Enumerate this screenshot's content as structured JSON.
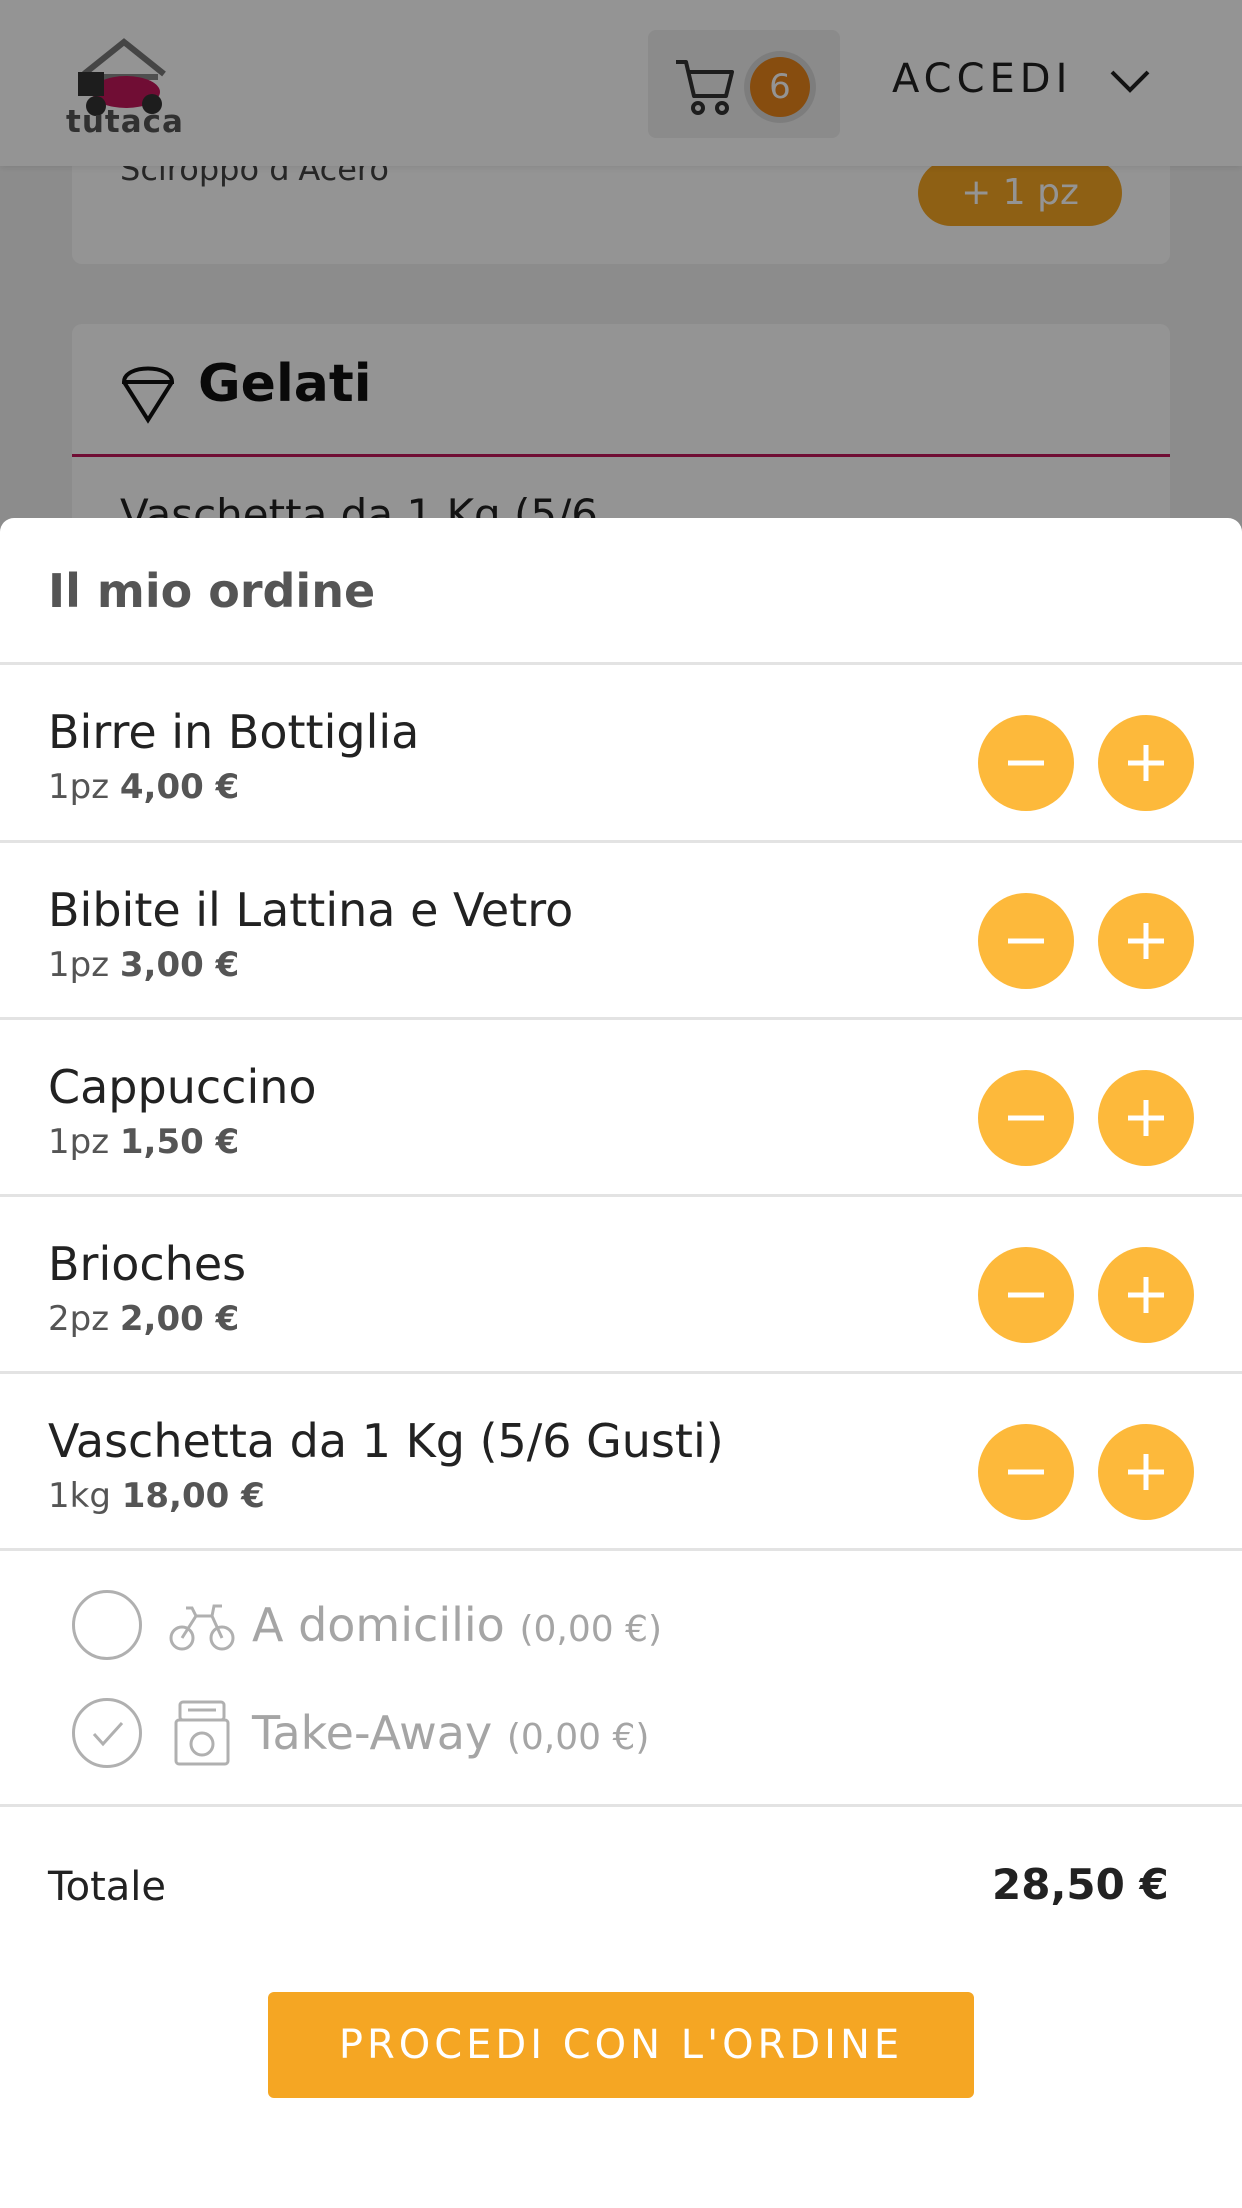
{
  "header": {
    "logo_text": "tutaca",
    "cart_count": "6",
    "login_label": "ACCEDI"
  },
  "background": {
    "syrup_text": "Sciroppo d'Acero",
    "add_pill": "+ 1 pz",
    "category_title": "Gelati",
    "tub_text": "Vaschetta da 1 Kg (5/6"
  },
  "order": {
    "title": "Il mio ordine",
    "items": [
      {
        "name": "Birre in Bottiglia",
        "qty": "1pz",
        "price": "4,00 €"
      },
      {
        "name": "Bibite il Lattina e Vetro",
        "qty": "1pz",
        "price": "3,00 €"
      },
      {
        "name": "Cappuccino",
        "qty": "1pz",
        "price": "1,50 €"
      },
      {
        "name": "Brioches",
        "qty": "2pz",
        "price": "2,00 €"
      },
      {
        "name": "Vaschetta da 1 Kg (5/6 Gusti)",
        "qty": "1kg",
        "price": "18,00 €"
      }
    ],
    "delivery_options": [
      {
        "label": "A domicilio",
        "price": "(0,00 €)",
        "icon": "scooter-icon",
        "selected": false
      },
      {
        "label": "Take-Away",
        "price": "(0,00 €)",
        "icon": "takeaway-bag-icon",
        "selected": true
      }
    ],
    "total_label": "Totale",
    "total_value": "28,50 €",
    "cta_label": "PROCEDI CON L'ORDINE"
  },
  "colors": {
    "accent": "#f5a623",
    "qty_button": "#fdb93b",
    "badge": "#e8851b",
    "brand": "#c2185b"
  }
}
